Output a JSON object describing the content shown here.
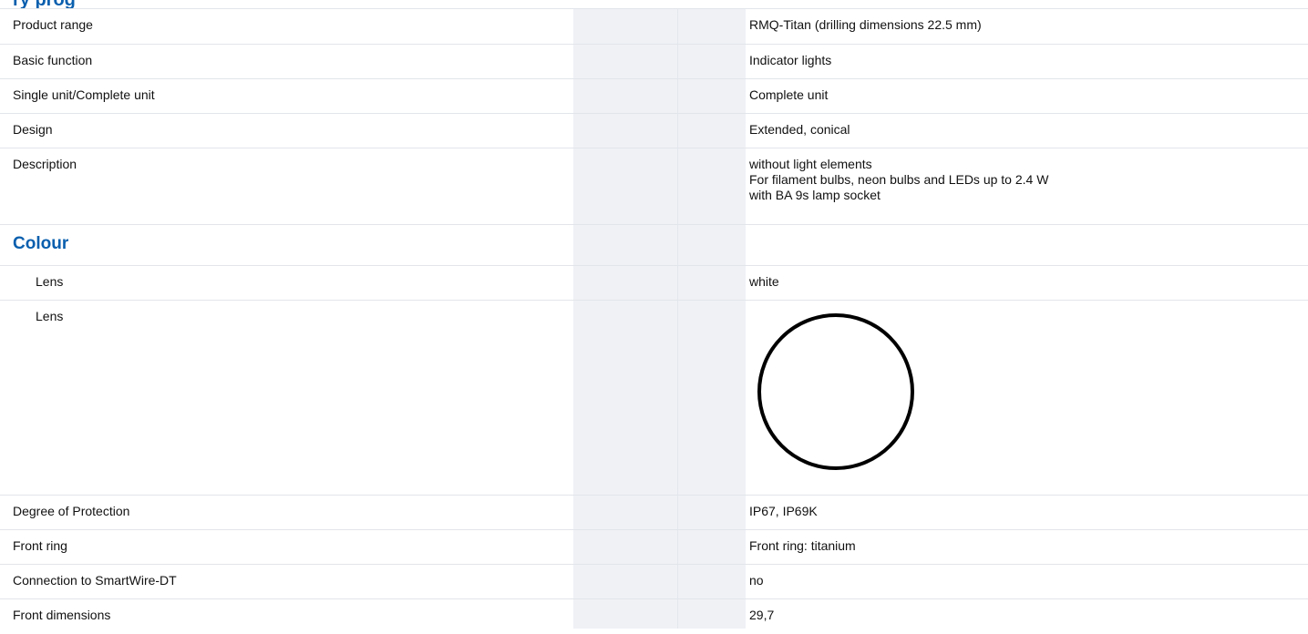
{
  "section_title_fragment": "ry prog",
  "rows": {
    "product_range": {
      "label": "Product range",
      "value": "RMQ-Titan (drilling dimensions 22.5 mm)"
    },
    "basic_function": {
      "label": "Basic function",
      "value": "Indicator lights"
    },
    "single_complete": {
      "label": "Single unit/Complete unit",
      "value": "Complete unit"
    },
    "design": {
      "label": "Design",
      "value": "Extended, conical"
    },
    "description": {
      "label": "Description",
      "lines": [
        "without light elements",
        "For filament bulbs, neon bulbs and LEDs up to 2.4 W",
        "with BA 9s lamp socket"
      ]
    },
    "lens": {
      "label": "Lens",
      "value": "white"
    },
    "lens_swatch": {
      "label": "Lens",
      "icon": "white-circle-swatch-icon",
      "swatch_fill": "#ffffff",
      "swatch_stroke": "#000000"
    },
    "degree_protection": {
      "label": "Degree of Protection",
      "value": "IP67, IP69K"
    },
    "front_ring": {
      "label": "Front ring",
      "value": "Front ring: titanium"
    },
    "smartwire": {
      "label": "Connection to SmartWire-DT",
      "value": "no"
    },
    "front_dimensions": {
      "label": "Front dimensions",
      "value": "29,7"
    }
  },
  "sections": {
    "colour": "Colour"
  },
  "colors": {
    "accent": "#0a5fae",
    "band": "#eff1f5",
    "divider": "#e2e5ea"
  }
}
